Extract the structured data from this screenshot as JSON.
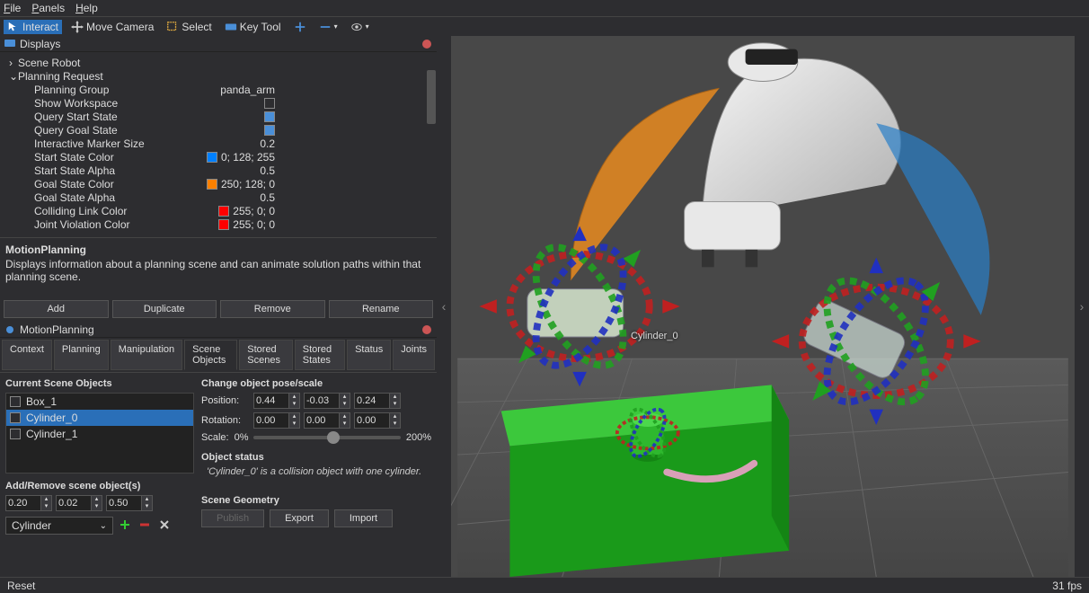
{
  "menu": {
    "items": [
      "File",
      "Panels",
      "Help"
    ]
  },
  "toolbar": {
    "interact": "Interact",
    "move_camera": "Move Camera",
    "select": "Select",
    "key_tool": "Key Tool"
  },
  "displays_panel": {
    "title": "Displays",
    "tree": {
      "scene_robot": "Scene Robot",
      "planning_request": "Planning Request",
      "rows": [
        {
          "label": "Planning Group",
          "value": "panda_arm"
        },
        {
          "label": "Show Workspace",
          "type": "checkbox",
          "checked": false
        },
        {
          "label": "Query Start State",
          "type": "checkbox",
          "checked": true
        },
        {
          "label": "Query Goal State",
          "type": "checkbox",
          "checked": true
        },
        {
          "label": "Interactive Marker Size",
          "value": "0.2"
        },
        {
          "label": "Start State Color",
          "type": "color",
          "color": "#0080ff",
          "text": "0; 128; 255"
        },
        {
          "label": "Start State Alpha",
          "value": "0.5"
        },
        {
          "label": "Goal State Color",
          "type": "color",
          "color": "#fa8000",
          "text": "250; 128; 0"
        },
        {
          "label": "Goal State Alpha",
          "value": "0.5"
        },
        {
          "label": "Colliding Link Color",
          "type": "color",
          "color": "#ff0000",
          "text": "255; 0; 0"
        },
        {
          "label": "Joint Violation Color",
          "type": "color",
          "color": "#ff0000",
          "text": "255; 0; 0"
        }
      ]
    },
    "desc": {
      "title": "MotionPlanning",
      "text": "Displays information about a planning scene and can animate solution paths within that planning scene."
    },
    "buttons": {
      "add": "Add",
      "duplicate": "Duplicate",
      "remove": "Remove",
      "rename": "Rename"
    }
  },
  "mp_panel": {
    "title": "MotionPlanning",
    "tabs": [
      "Context",
      "Planning",
      "Manipulation",
      "Scene Objects",
      "Stored Scenes",
      "Stored States",
      "Status",
      "Joints"
    ],
    "active_tab": 3,
    "current_objects_title": "Current Scene Objects",
    "objects": [
      "Box_1",
      "Cylinder_0",
      "Cylinder_1"
    ],
    "selected_object": 1,
    "change_pose_title": "Change object pose/scale",
    "position_label": "Position:",
    "rotation_label": "Rotation:",
    "position": [
      "0.44",
      "-0.03",
      "0.24"
    ],
    "rotation": [
      "0.00",
      "0.00",
      "0.00"
    ],
    "scale_label": "Scale:",
    "scale_min": "0%",
    "scale_max": "200%",
    "status_title": "Object status",
    "status_text": "'Cylinder_0' is a collision object with one cylinder.",
    "addrem_title": "Add/Remove scene object(s)",
    "addrem_vals": [
      "0.20",
      "0.02",
      "0.50"
    ],
    "shape": "Cylinder",
    "geom_title": "Scene Geometry",
    "publish": "Publish",
    "export": "Export",
    "import": "Import"
  },
  "viewport": {
    "object_label": "Cylinder_0"
  },
  "statusbar": {
    "reset": "Reset",
    "fps": "31 fps"
  }
}
